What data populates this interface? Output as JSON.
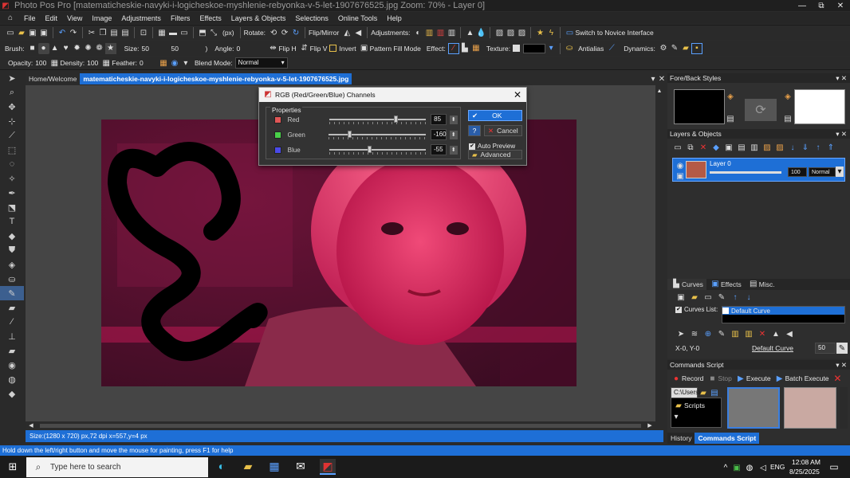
{
  "window": {
    "title": "Photo Pos Pro [matematicheskie-navyki-i-logicheskoe-myshlenie-rebyonka-v-5-let-1907676525.jpg  Zoom: 70% - Layer 0]",
    "controls": [
      "—",
      "⧉",
      "✕"
    ]
  },
  "menu": [
    "File",
    "Edit",
    "View",
    "Image",
    "Adjustments",
    "Filters",
    "Effects",
    "Layers & Objects",
    "Selections",
    "Online Tools",
    "Help"
  ],
  "toolbar1": {
    "units": "(px)",
    "rotate_label": "Rotate:",
    "flipmirror_label": "Flip/Mirror",
    "adjustments_label": "Adjustments:",
    "switch_label": "Switch to Novice Interface"
  },
  "toolbar2": {
    "brush_label": "Brush:",
    "size_label": "Size:",
    "size_value": "50",
    "size_value2": "50",
    "angle_label": "Angle:",
    "angle_value": "0",
    "fliph_label": "Flip H",
    "flipv_label": "Flip V",
    "invert_label": "Invert",
    "pattern_label": "Pattern Fill Mode",
    "effect_label": "Effect:",
    "texture_label": "Texture:",
    "antialias_label": "Antialias",
    "dynamics_label": "Dynamics:"
  },
  "toolbar3": {
    "opacity_label": "Opacity:",
    "opacity_value": "100",
    "density_label": "Density:",
    "density_value": "100",
    "feather_label": "Feather:",
    "feather_value": "0",
    "blend_label": "Blend Mode:",
    "blend_value": "Normal"
  },
  "tabs": [
    "Home/Welcome",
    "matematicheskie-navyki-i-logicheskoe-myshlenie-rebyonka-v-5-let-1907676525.jpg"
  ],
  "doc_status": "Size:(1280 x 720) px,72 dpi   x=557,y=4 px",
  "status": "Hold down the left/right button and move the mouse for painting, press F1 for help",
  "dialog": {
    "title": "RGB (Red/Green/Blue) Channels",
    "group": "Properties",
    "channels": [
      {
        "name": "Red",
        "value": "85",
        "level": 0.66,
        "color": "#e05656"
      },
      {
        "name": "Green",
        "value": "-160",
        "level": 0.19,
        "color": "#49d049"
      },
      {
        "name": "Blue",
        "value": "-55",
        "level": 0.39,
        "color": "#4a4ae8"
      }
    ],
    "ok": "OK",
    "cancel": "Cancel",
    "auto_preview": "Auto Preview",
    "advanced": "Advanced"
  },
  "panels": {
    "foreback": "Fore/Back Styles",
    "layers": "Layers & Objects",
    "layer_name": "Layer 0",
    "layer_opacity": "100",
    "layer_mode": "Normal",
    "curves_tab": "Curves",
    "effects_tab": "Effects",
    "misc_tab": "Misc.",
    "curves_list_label": "Curves List:",
    "curves_item": "Default Curve",
    "coord": "X-0, Y-0",
    "curve_link": "Default Curve",
    "curve_num": "50",
    "commands": "Commands Script",
    "record": "Record",
    "stop": "Stop",
    "execute": "Execute",
    "batch": "Batch Execute",
    "path": "C:\\Users\\",
    "scripts": "Scripts",
    "history_tab": "History",
    "commands_tab": "Commands Script"
  },
  "taskbar": {
    "search": "Type here to search",
    "lang": "ENG",
    "time": "12:08 AM",
    "date": "8/25/2025"
  },
  "colors": {
    "accent": "#1e6fd6",
    "image_tint": "#e0245e"
  }
}
